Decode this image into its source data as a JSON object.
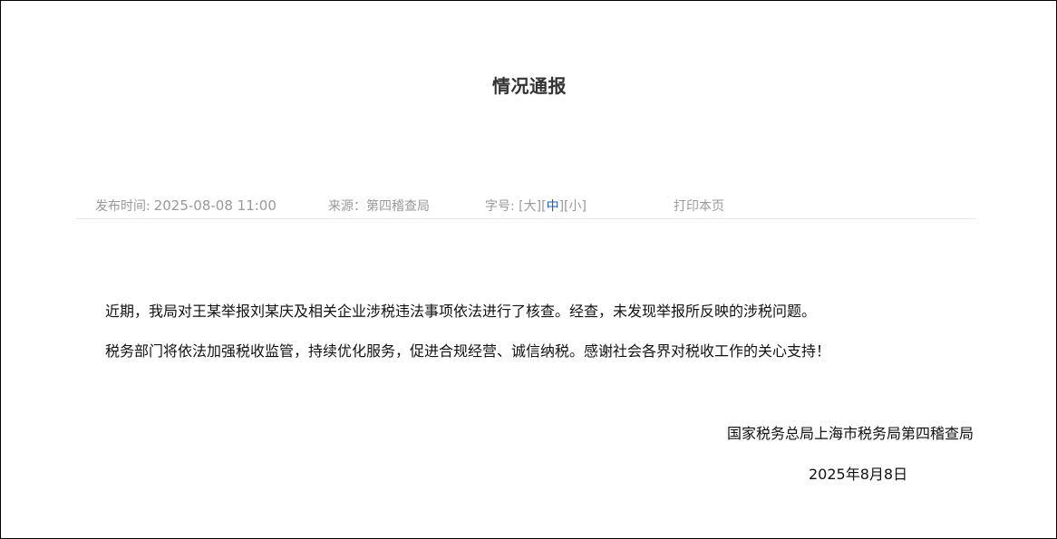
{
  "article": {
    "title": "情况通报",
    "meta": {
      "publish_label": "发布时间:",
      "publish_value": "2025-08-08 11:00",
      "source": "来源：第四稽查局",
      "fontsize_label": "字号:",
      "fontsize_options": [
        {
          "label": "大",
          "active": false
        },
        {
          "label": "中",
          "active": true
        },
        {
          "label": "小",
          "active": false
        }
      ],
      "print_label": "打印本页"
    },
    "paragraphs": [
      "近期，我局对王某举报刘某庆及相关企业涉税违法事项依法进行了核查。经查，未发现举报所反映的涉税问题。",
      "税务部门将依法加强税收监管，持续优化服务，促进合规经营、诚信纳税。感谢社会各界对税收工作的关心支持！"
    ],
    "signature": {
      "org": "国家税务总局上海市税务局第四稽查局",
      "date": "2025年8月8日"
    }
  },
  "colors": {
    "meta_text": "#999999",
    "active_fontsize": "#1f5bb4",
    "divider": "#e6e6e6",
    "body_text": "#111111"
  }
}
